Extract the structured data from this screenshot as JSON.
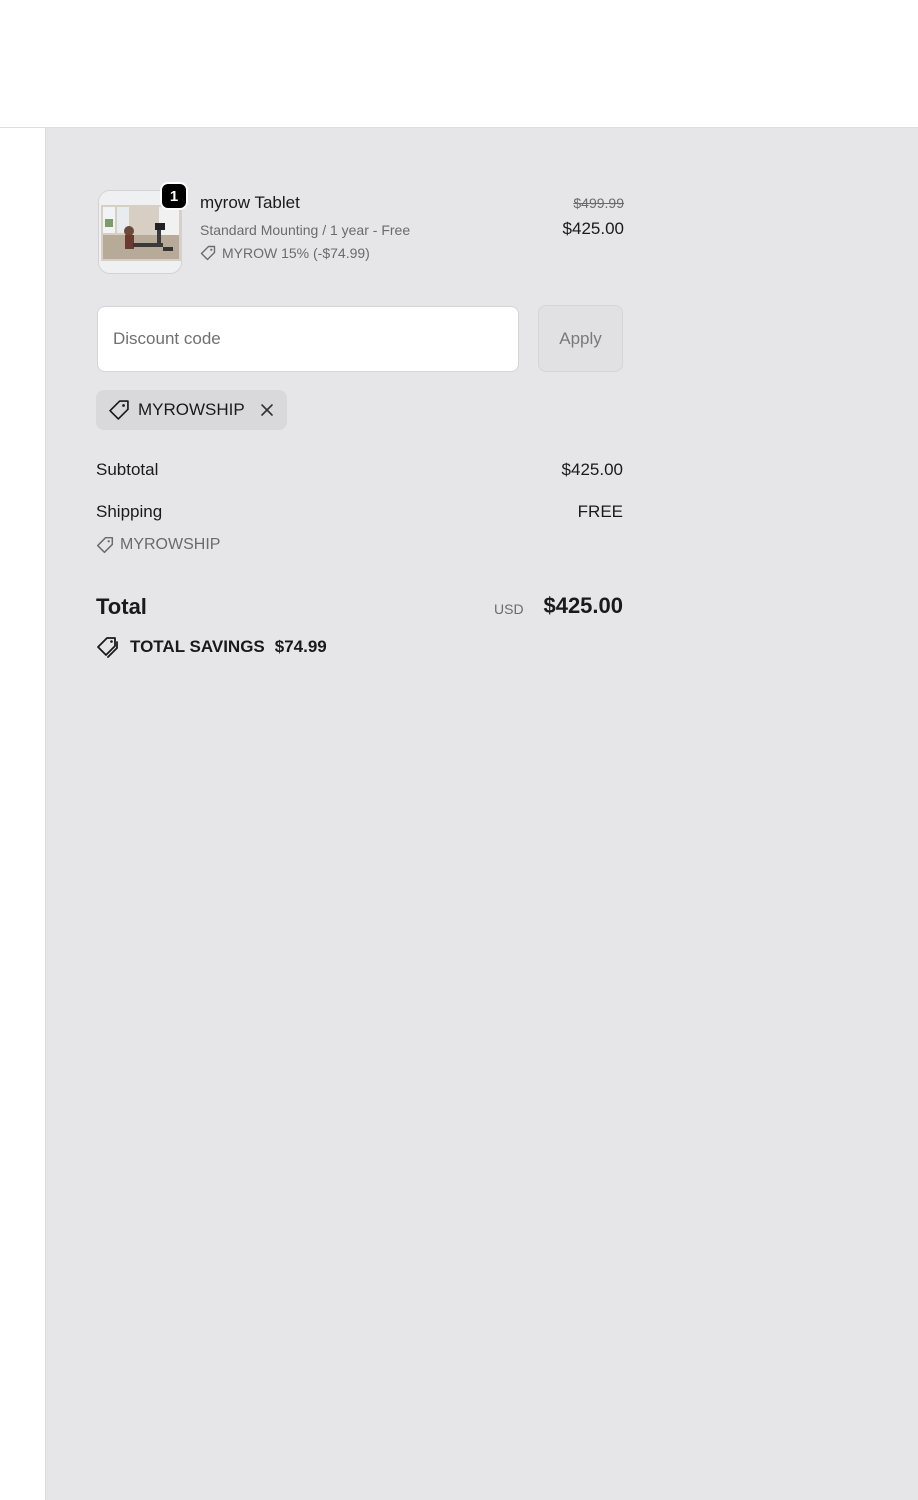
{
  "cart": {
    "item": {
      "name": "myrow Tablet",
      "variant": "Standard Mounting / 1 year - Free",
      "discount": "MYROW 15% (-$74.99)",
      "quantity": "1",
      "original_price": "$499.99",
      "price": "$425.00",
      "image_icon": "product-photo"
    }
  },
  "discount": {
    "placeholder": "Discount code",
    "apply_label": "Apply",
    "applied_code": "MYROWSHIP"
  },
  "summary": {
    "subtotal_label": "Subtotal",
    "subtotal_value": "$425.00",
    "shipping_label": "Shipping",
    "shipping_value": "FREE",
    "shipping_code": "MYROWSHIP",
    "total_label": "Total",
    "currency": "USD",
    "total_value": "$425.00",
    "savings_label": "TOTAL SAVINGS",
    "savings_value": "$74.99"
  },
  "colors": {
    "summary_bg": "#e6e6e9",
    "badge_bg": "#000000",
    "chip_bg": "#d9d9dc"
  }
}
